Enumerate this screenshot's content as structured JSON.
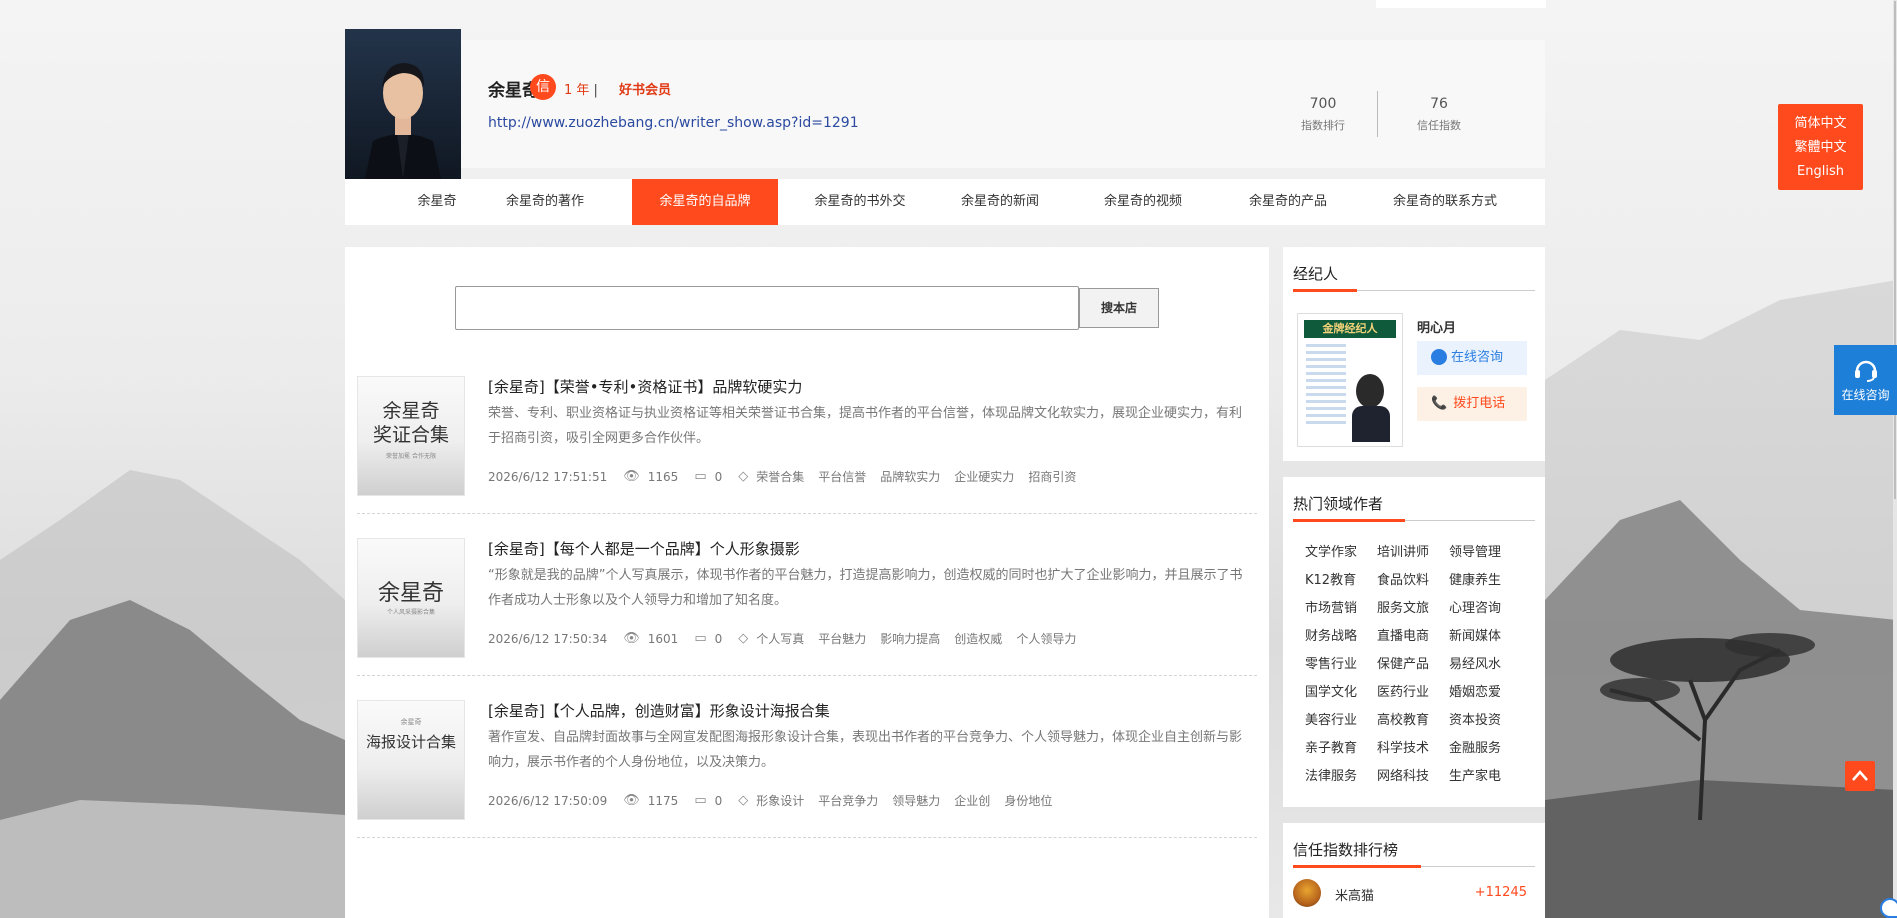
{
  "colors": {
    "accent": "#ff4a1e",
    "link": "#2b4aa0",
    "blue": "#1e7fd8"
  },
  "writer": {
    "name": "余星奇",
    "badge": "信",
    "years": "1 年",
    "years_sep": "|",
    "member": "好书会员",
    "url": "http://www.zuozhebang.cn/writer_show.asp?id=1291",
    "stats": [
      {
        "value": "700",
        "label": "指数排行"
      },
      {
        "value": "76",
        "label": "信任指数"
      }
    ]
  },
  "nav": [
    "余星奇",
    "余星奇的著作",
    "余星奇的自品牌",
    "余星奇的书外交",
    "余星奇的新闻",
    "余星奇的视频",
    "余星奇的产品",
    "余星奇的联系方式"
  ],
  "nav_active_index": 2,
  "search": {
    "placeholder": "",
    "button": "搜本店"
  },
  "articles": [
    {
      "title": "[余星奇]【荣誉•专利•资格证书】品牌软硬实力",
      "desc": "荣誉、专利、职业资格证与执业资格证等相关荣誉证书合集，提高书作者的平台信誉，体现品牌文化软实力，展现企业硬实力，有利于招商引资，吸引全网更多合作伙伴。",
      "date": "2026/6/12 17:51:51",
      "views": "1165",
      "comments": "0",
      "tags": [
        "荣誉合集",
        "平台信誉",
        "品牌软实力",
        "企业硬实力",
        "招商引资"
      ],
      "thumb_title": "余星奇\n奖证合集",
      "thumb_sub": "荣誉加冕 合作无限"
    },
    {
      "title": "[余星奇]【每个人都是一个品牌】个人形象摄影",
      "desc": "“形象就是我的品牌”个人写真展示，体现书作者的平台魅力，打造提高影响力，创造权威的同时也扩大了企业影响力，并且展示了书作者成功人士形象以及个人领导力和增加了知名度。",
      "date": "2026/6/12 17:50:34",
      "views": "1601",
      "comments": "0",
      "tags": [
        "个人写真",
        "平台魅力",
        "影响力提高",
        "创造权威",
        "个人领导力"
      ],
      "thumb_title": "余星奇",
      "thumb_sub": "个人风采摄影合集"
    },
    {
      "title": "[余星奇]【个人品牌，创造财富】形象设计海报合集",
      "desc": "著作宣发、自品牌封面故事与全网宣发配图海报形象设计合集，表现出书作者的平台竞争力、个人领导魅力，体现企业自主创新与影响力，展示书作者的个人身份地位，以及决策力。",
      "date": "2026/6/12 17:50:09",
      "views": "1175",
      "comments": "0",
      "tags": [
        "形象设计",
        "平台竞争力",
        "领导魅力",
        "企业创",
        "身份地位"
      ],
      "thumb_title": "海报设计合集",
      "thumb_sub": "余星奇"
    }
  ],
  "agent": {
    "heading": "经纪人",
    "name": "明心月",
    "consult": "在线咨询",
    "call": "拨打电话",
    "poster_title": "金牌经纪人"
  },
  "hot": {
    "heading": "热门领域作者",
    "items": [
      "文学作家",
      "培训讲师",
      "领导管理",
      "K12教育",
      "食品饮料",
      "健康养生",
      "市场营销",
      "服务文旅",
      "心理咨询",
      "财务战略",
      "直播电商",
      "新闻媒体",
      "零售行业",
      "保健产品",
      "易经风水",
      "国学文化",
      "医药行业",
      "婚姻恋爱",
      "美容行业",
      "高校教育",
      "资本投资",
      "亲子教育",
      "科学技术",
      "金融服务",
      "法律服务",
      "网络科技",
      "生产家电"
    ]
  },
  "ranking": {
    "heading": "信任指数排行榜",
    "rows": [
      {
        "name": "米高猫",
        "value": "+11245"
      }
    ]
  },
  "language": [
    "简体中文",
    "繁體中文",
    "English"
  ],
  "float_consult": "在线咨询"
}
